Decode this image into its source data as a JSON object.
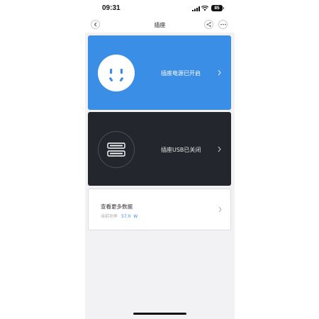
{
  "status_bar": {
    "time": "09:31",
    "battery": "85"
  },
  "nav": {
    "title": "插座"
  },
  "power_card": {
    "label": "插座电源已开启",
    "color": "#3a8ee6"
  },
  "usb_card": {
    "label": "插座USB已关闭",
    "color": "#23262c"
  },
  "data_card": {
    "title": "查看更多数据",
    "power_label": "当前功率",
    "power_value": "57.0",
    "power_unit": "W"
  },
  "icons": {
    "back": "chevron-left-icon",
    "share": "share-icon",
    "more": "more-dots-icon",
    "power": "power-socket-icon",
    "usb": "usb-port-icon"
  }
}
